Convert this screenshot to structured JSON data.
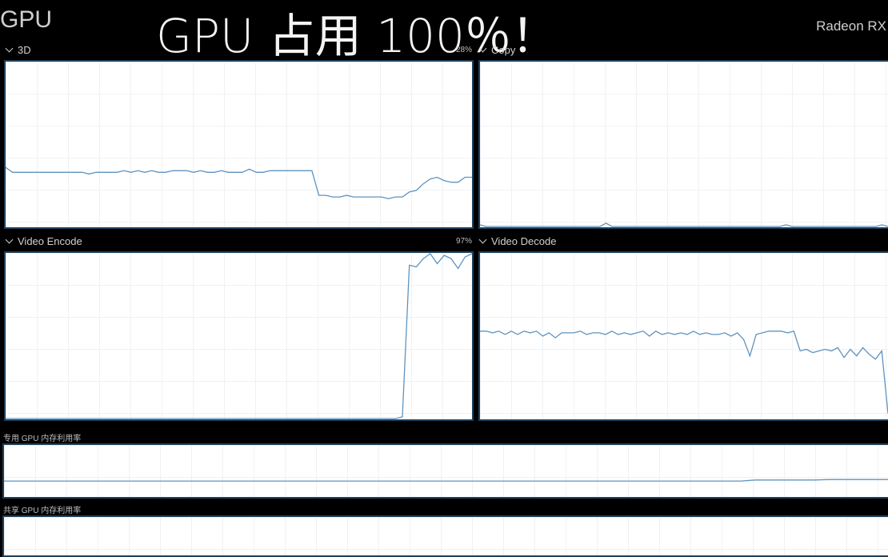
{
  "header": {
    "title": "GPU",
    "overlay_caption": "GPU 占用 100％！",
    "adapter_name": "Radeon RX"
  },
  "engines": [
    {
      "label": "3D",
      "percent": "28%",
      "samples": [
        0.36,
        0.33,
        0.33,
        0.33,
        0.33,
        0.33,
        0.33,
        0.33,
        0.33,
        0.33,
        0.33,
        0.33,
        0.32,
        0.33,
        0.33,
        0.33,
        0.33,
        0.34,
        0.33,
        0.34,
        0.33,
        0.34,
        0.33,
        0.33,
        0.34,
        0.34,
        0.34,
        0.33,
        0.34,
        0.33,
        0.33,
        0.34,
        0.33,
        0.33,
        0.33,
        0.35,
        0.33,
        0.33,
        0.34,
        0.34,
        0.34,
        0.34,
        0.34,
        0.34,
        0.34,
        0.19,
        0.19,
        0.18,
        0.18,
        0.19,
        0.18,
        0.18,
        0.18,
        0.18,
        0.18,
        0.17,
        0.18,
        0.18,
        0.21,
        0.22,
        0.26,
        0.29,
        0.3,
        0.28,
        0.27,
        0.27,
        0.3,
        0.3
      ]
    },
    {
      "label": "Copy",
      "percent": "",
      "samples": [
        0.01,
        0.0,
        0.0,
        0.0,
        0.0,
        0.0,
        0.0,
        0.0,
        0.0,
        0.0,
        0.0,
        0.0,
        0.0,
        0.0,
        0.0,
        0.0,
        0.0,
        0.0,
        0.0,
        0.0,
        0.0,
        0.02,
        0.0,
        0.0,
        0.0,
        0.0,
        0.0,
        0.0,
        0.0,
        0.0,
        0.0,
        0.0,
        0.0,
        0.0,
        0.0,
        0.0,
        0.0,
        0.0,
        0.0,
        0.0,
        0.0,
        0.0,
        0.0,
        0.0,
        0.0,
        0.0,
        0.0,
        0.0,
        0.0,
        0.0,
        0.0,
        0.01,
        0.0,
        0.0,
        0.0,
        0.0,
        0.0,
        0.0,
        0.0,
        0.0,
        0.0,
        0.0,
        0.0,
        0.0,
        0.0,
        0.0,
        0.0,
        0.01,
        0.0
      ]
    },
    {
      "label": "Video Encode",
      "percent": "97%",
      "samples": [
        0,
        0,
        0,
        0,
        0,
        0,
        0,
        0,
        0,
        0,
        0,
        0,
        0,
        0,
        0,
        0,
        0,
        0,
        0,
        0,
        0,
        0,
        0,
        0,
        0,
        0,
        0,
        0,
        0,
        0,
        0,
        0,
        0,
        0,
        0,
        0,
        0,
        0,
        0,
        0,
        0,
        0,
        0,
        0,
        0,
        0,
        0,
        0,
        0,
        0,
        0,
        0,
        0,
        0,
        0,
        0,
        0,
        0.01,
        0.93,
        0.92,
        0.97,
        1.0,
        0.94,
        0.99,
        0.97,
        0.91,
        0.98,
        1.0
      ]
    },
    {
      "label": "Video Decode",
      "percent": "",
      "samples": [
        0.53,
        0.53,
        0.52,
        0.53,
        0.51,
        0.53,
        0.51,
        0.53,
        0.52,
        0.53,
        0.5,
        0.52,
        0.49,
        0.52,
        0.52,
        0.52,
        0.53,
        0.51,
        0.52,
        0.52,
        0.51,
        0.53,
        0.51,
        0.52,
        0.51,
        0.52,
        0.53,
        0.5,
        0.53,
        0.51,
        0.52,
        0.51,
        0.52,
        0.51,
        0.53,
        0.51,
        0.52,
        0.51,
        0.51,
        0.52,
        0.5,
        0.52,
        0.48,
        0.38,
        0.51,
        0.52,
        0.53,
        0.53,
        0.53,
        0.52,
        0.53,
        0.41,
        0.42,
        0.4,
        0.41,
        0.42,
        0.41,
        0.43,
        0.37,
        0.42,
        0.38,
        0.43,
        0.39,
        0.36,
        0.41,
        0.03
      ]
    }
  ],
  "memory": [
    {
      "label": "专用 GPU 内存利用率",
      "samples": [
        0.3,
        0.3,
        0.3,
        0.3,
        0.3,
        0.3,
        0.3,
        0.3,
        0.3,
        0.3,
        0.3,
        0.3,
        0.3,
        0.3,
        0.3,
        0.3,
        0.3,
        0.3,
        0.3,
        0.3,
        0.3,
        0.3,
        0.3,
        0.3,
        0.3,
        0.3,
        0.3,
        0.3,
        0.3,
        0.3,
        0.3,
        0.3,
        0.3,
        0.3,
        0.3,
        0.3,
        0.3,
        0.3,
        0.3,
        0.3,
        0.3,
        0.3,
        0.3,
        0.3,
        0.3,
        0.3,
        0.3,
        0.3,
        0.3,
        0.3,
        0.3,
        0.32,
        0.32,
        0.32,
        0.32,
        0.32,
        0.33,
        0.33,
        0.33,
        0.33,
        0.33
      ]
    },
    {
      "label": "共享 GPU 内存利用率",
      "samples": []
    }
  ]
}
